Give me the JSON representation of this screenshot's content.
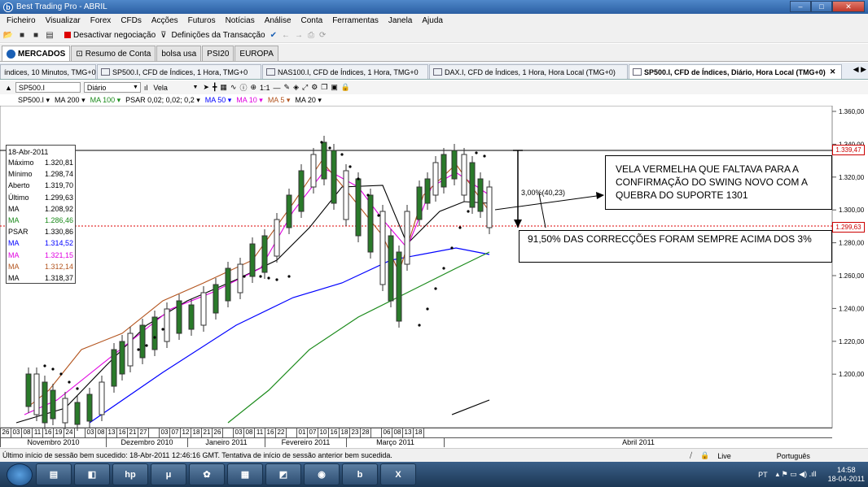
{
  "window": {
    "title": "Best Trading Pro - ABRIL"
  },
  "menu": [
    "Ficheiro",
    "Visualizar",
    "Forex",
    "CFDs",
    "Acções",
    "Futuros",
    "Notícias",
    "Análise",
    "Conta",
    "Ferramentas",
    "Janela",
    "Ajuda"
  ],
  "toolbar": {
    "deactivate": "Desactivar negociação",
    "settings": "Definições da Transacção"
  },
  "main_tabs": [
    "MERCADOS",
    "Resumo de Conta",
    "bolsa usa",
    "PSI20",
    "EUROPA"
  ],
  "chart_tabs": [
    "índices, 10 Minutos, TMG+0",
    "SP500.I, CFD de Índices, 1 Hora, TMG+0",
    "NAS100.I, CFD de Índices, 1 Hora, TMG+0",
    "DAX.I, CFD de Índices, 1 Hora, Hora Local (TMG+0)",
    "SP500.I, CFD de Índices, Diário, Hora Local (TMG+0)"
  ],
  "chart_toolbar": {
    "symbol": "SP500.I",
    "period": "Diário",
    "chart_type": "Vela"
  },
  "indicators": [
    {
      "label": "SP500.I ▾",
      "color": "#000000"
    },
    {
      "label": "MA 200 ▾",
      "color": "#000000"
    },
    {
      "label": "MA 100 ▾",
      "color": "#1a8a1a"
    },
    {
      "label": "PSAR 0,02; 0,02; 0,2 ▾",
      "color": "#000000"
    },
    {
      "label": "MA 50 ▾",
      "color": "#0000ff"
    },
    {
      "label": "MA 10 ▾",
      "color": "#e000e0"
    },
    {
      "label": "MA 5 ▾",
      "color": "#b3541e"
    },
    {
      "label": "MA 20 ▾",
      "color": "#000000"
    }
  ],
  "info": {
    "date": "18-Abr-2011",
    "rows": [
      {
        "k": "Máximo",
        "v": "1.320,81",
        "c": "#000"
      },
      {
        "k": "Mínimo",
        "v": "1.298,74",
        "c": "#000"
      },
      {
        "k": "Aberto",
        "v": "1.319,70",
        "c": "#000"
      },
      {
        "k": "Último",
        "v": "1.299,63",
        "c": "#000"
      },
      {
        "k": "MA",
        "v": "1.208,92",
        "c": "#000"
      },
      {
        "k": "MA",
        "v": "1.286,46",
        "c": "#1a8a1a"
      },
      {
        "k": "PSAR",
        "v": "1.330,86",
        "c": "#000"
      },
      {
        "k": "MA",
        "v": "1.314,52",
        "c": "#0000ff"
      },
      {
        "k": "MA",
        "v": "1.321,15",
        "c": "#e000e0"
      },
      {
        "k": "MA",
        "v": "1.312,14",
        "c": "#b3541e"
      },
      {
        "k": "MA",
        "v": "1.318,37",
        "c": "#000"
      }
    ]
  },
  "price_labels": {
    "high_line": "1.339,47",
    "last": "1.299,63"
  },
  "annotations": {
    "box1": "VELA VERMELHA QUE FALTAVA PARA A CONFIRMAÇÃO DO SWING NOVO COM A QUEBRA DO SUPORTE 1301",
    "box2": "91,50% DAS CORRECÇÕES FORAM SEMPRE ACIMA DOS 3%",
    "pct": "3,00%(40,23)"
  },
  "y_axis": [
    "1.360,00",
    "1.340,00",
    "1.320,00",
    "1.300,00",
    "1.280,00",
    "1.260,00",
    "1.240,00",
    "1.220,00",
    "1.200,00"
  ],
  "x_days": [
    "26",
    "03",
    "08",
    "11",
    "16",
    "19",
    "24",
    "",
    "03",
    "08",
    "13",
    "16",
    "21",
    "27",
    "",
    "03",
    "07",
    "12",
    "18",
    "21",
    "26",
    "",
    "03",
    "08",
    "11",
    "16",
    "22",
    "",
    "01",
    "07",
    "10",
    "16",
    "18",
    "23",
    "28",
    "",
    "06",
    "08",
    "13",
    "18"
  ],
  "months": [
    "Novembro 2010",
    "Dezembro 2010",
    "Janeiro 2011",
    "Fevereiro 2011",
    "Março 2011",
    "Abril 2011"
  ],
  "status": {
    "text": "Último início de sessão bem sucedido: 18-Abr-2011 12:46:16 GMT. Tentativa de início de sessão anterior bem sucedida.",
    "live": "Live",
    "lang": "Português"
  },
  "taskbar": {
    "lang": "PT",
    "time": "14:58",
    "date": "18-04-2011"
  }
}
